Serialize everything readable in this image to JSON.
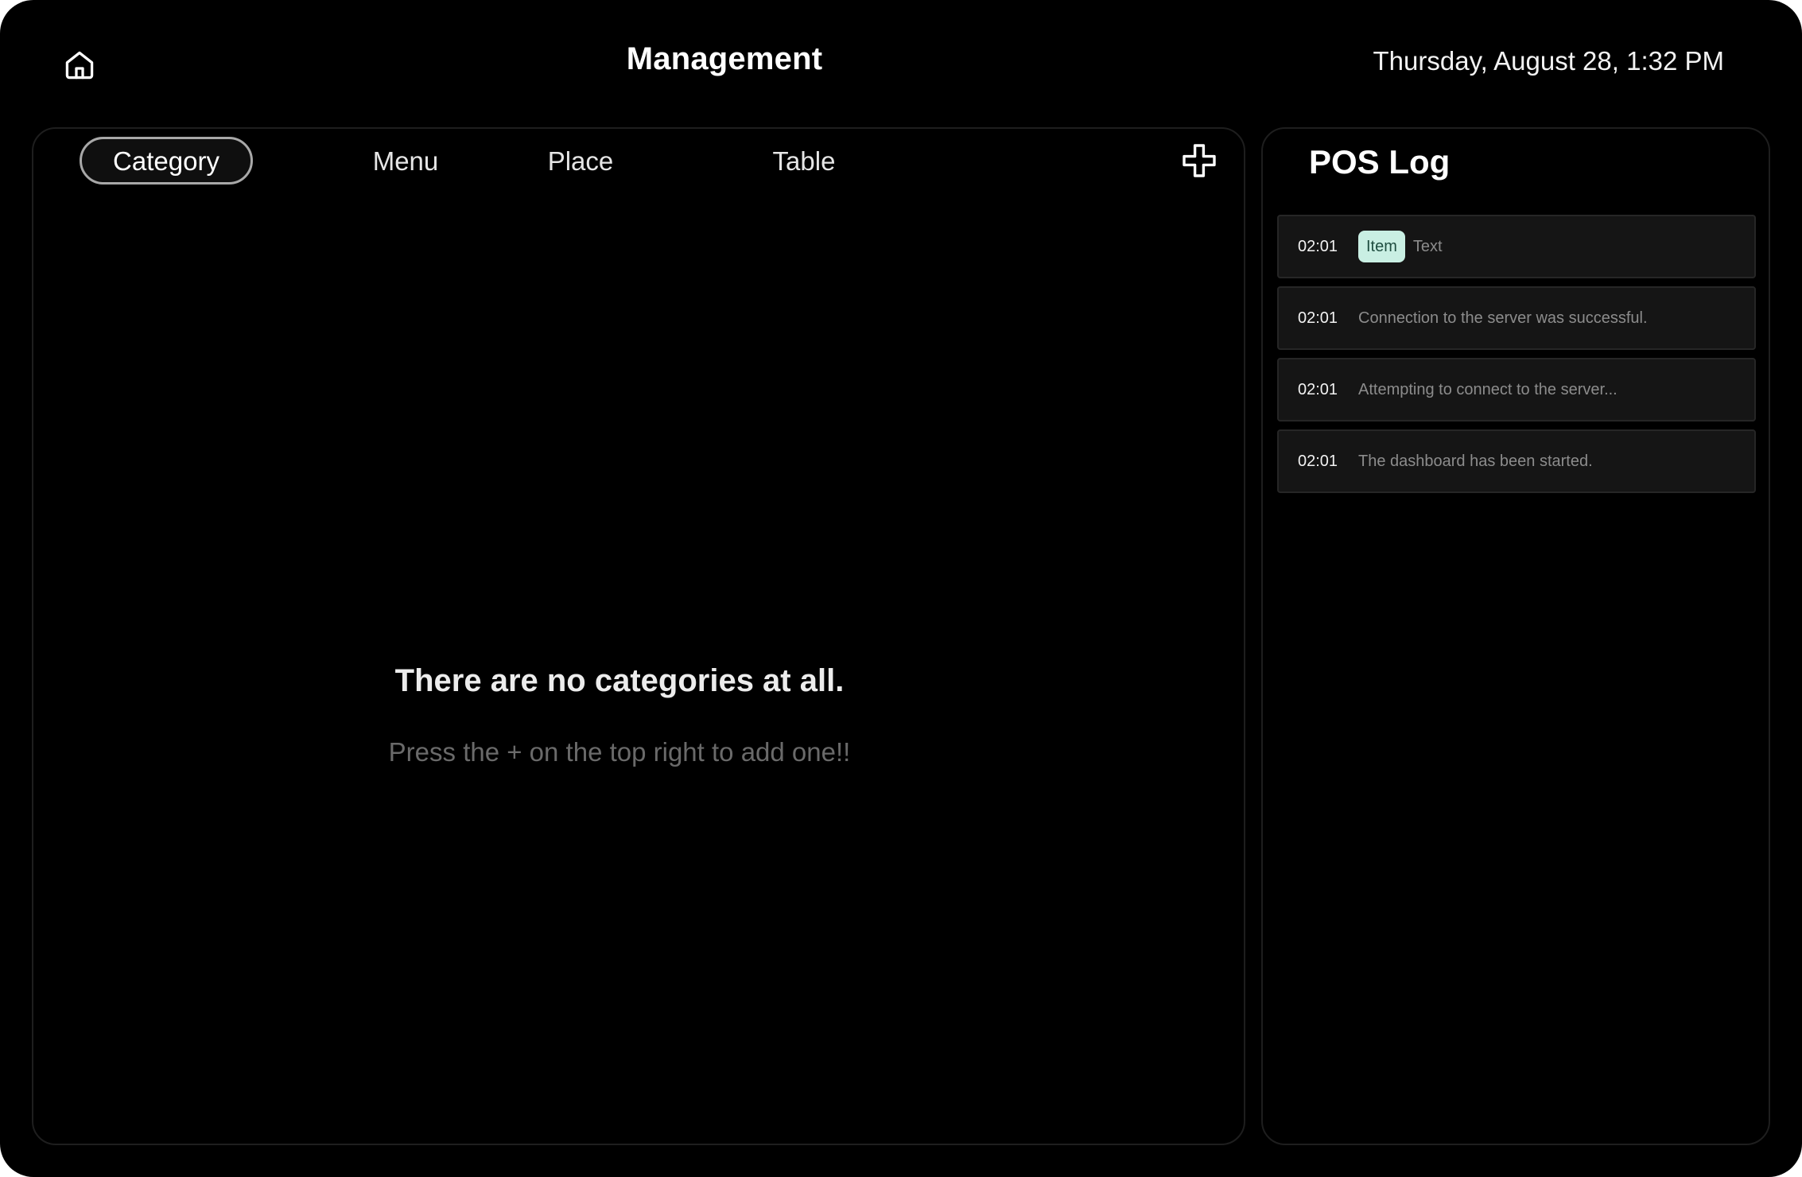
{
  "header": {
    "title": "Management",
    "datetime": "Thursday, August 28, 1:32 PM",
    "home_icon": "home-icon"
  },
  "management": {
    "tabs": [
      {
        "label": "Category",
        "active": true
      },
      {
        "label": "Menu",
        "active": false
      },
      {
        "label": "Place",
        "active": false
      },
      {
        "label": "Table",
        "active": false
      }
    ],
    "add_icon": "plus-icon",
    "empty_state": {
      "title": "There are no categories at all.",
      "hint": "Press the + on the top right to add one!!"
    }
  },
  "pos_log": {
    "title": "POS Log",
    "entries": [
      {
        "time": "02:01",
        "badge": "Item",
        "text": "Text"
      },
      {
        "time": "02:01",
        "text": "Connection to the server was successful."
      },
      {
        "time": "02:01",
        "text": "Attempting to connect to the server..."
      },
      {
        "time": "02:01",
        "text": "The dashboard has been started."
      }
    ]
  },
  "colors": {
    "background": "#000000",
    "panel_border": "#1e1e1e",
    "badge_bg": "#c9efe3",
    "hint_text": "#6a6a6a"
  }
}
